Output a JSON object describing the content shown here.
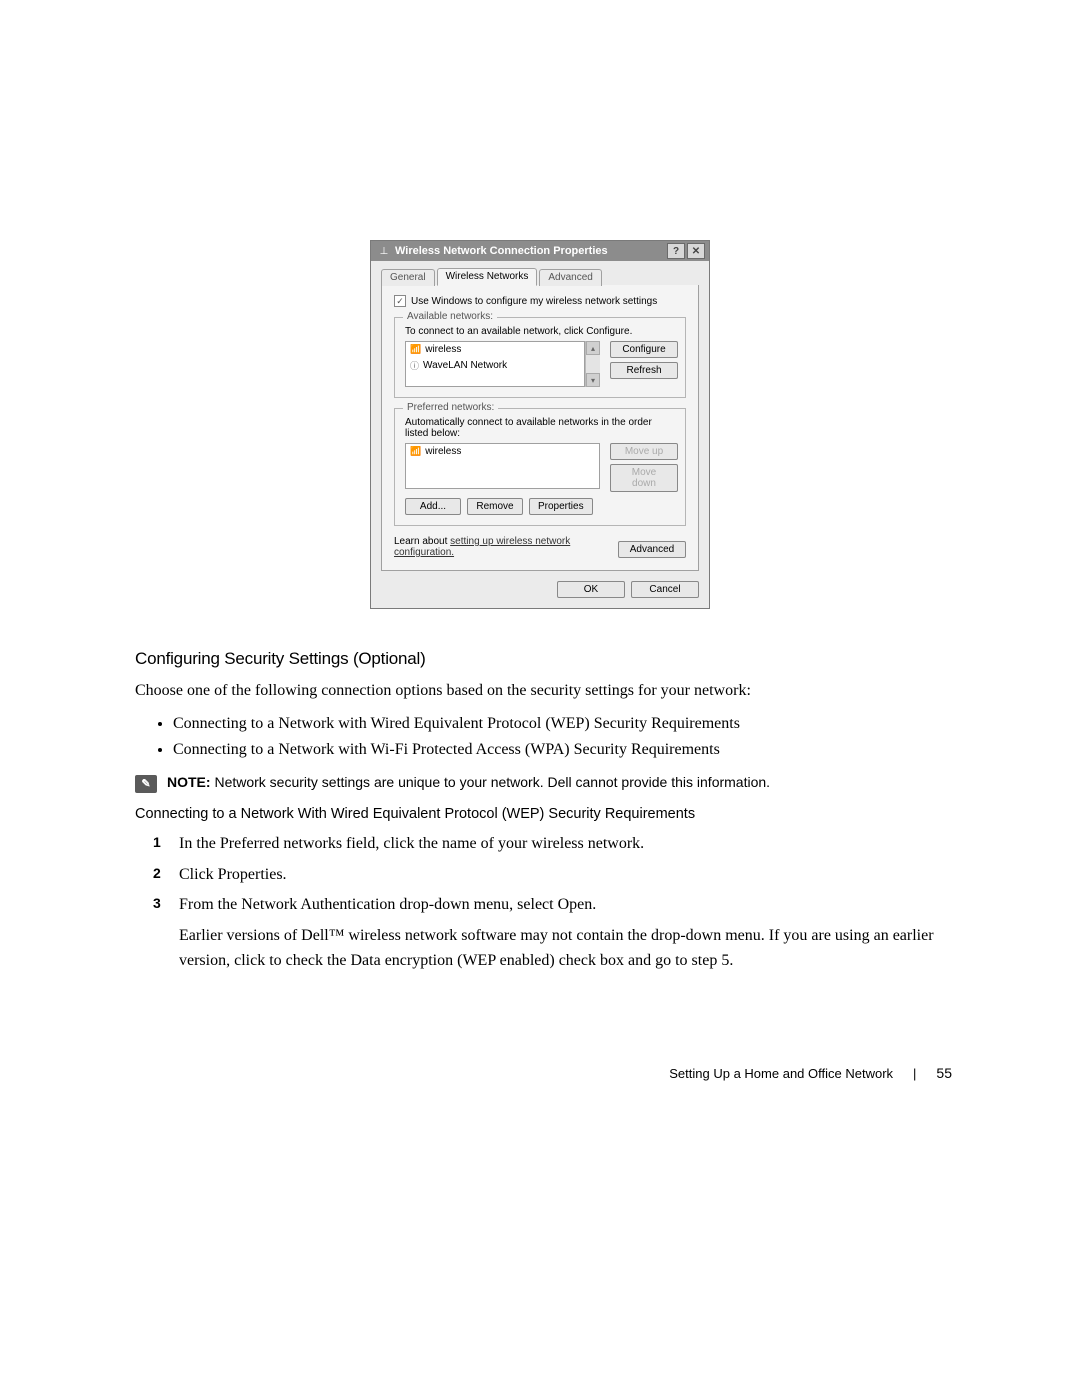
{
  "dialog": {
    "title": "Wireless Network Connection Properties",
    "tabs": {
      "general": "General",
      "wireless": "Wireless Networks",
      "advanced": "Advanced"
    },
    "checkbox_label": "Use Windows to configure my wireless network settings",
    "available": {
      "legend": "Available networks:",
      "hint": "To connect to an available network, click Configure.",
      "items": [
        "wireless",
        "WaveLAN Network"
      ],
      "configure_btn": "Configure",
      "refresh_btn": "Refresh"
    },
    "preferred": {
      "legend": "Preferred networks:",
      "hint": "Automatically connect to available networks in the order listed below:",
      "items": [
        "wireless"
      ],
      "moveup_btn": "Move up",
      "movedown_btn": "Move down",
      "add_btn": "Add...",
      "remove_btn": "Remove",
      "properties_btn": "Properties"
    },
    "learn_prefix": "Learn about ",
    "learn_link": "setting up wireless network configuration.",
    "advanced_btn": "Advanced",
    "ok_btn": "OK",
    "cancel_btn": "Cancel"
  },
  "doc": {
    "h_config": "Configuring Security Settings (Optional)",
    "intro": "Choose one of the following connection options based on the security settings for your network:",
    "bullet1": "Connecting to a Network with Wired Equivalent Protocol (WEP) Security Requirements",
    "bullet2": "Connecting to a Network with Wi-Fi Protected Access (WPA) Security Requirements",
    "note_label": "NOTE:",
    "note_text": " Network security settings are unique to your network. Dell cannot provide this information.",
    "sub_wep": "Connecting to a Network With Wired Equivalent Protocol (WEP) Security Requirements",
    "step1": "In the Preferred networks field, click the name of your wireless network.",
    "step2": "Click Properties.",
    "step3": "From the Network Authentication drop-down menu, select Open.",
    "step3b": "Earlier versions of Dell™ wireless network software may not contain the drop-down menu. If you are using an earlier version, click to check the Data encryption (WEP enabled) check box and go to step 5.",
    "footer_section": "Setting Up a Home and Office Network",
    "page_num": "55"
  }
}
